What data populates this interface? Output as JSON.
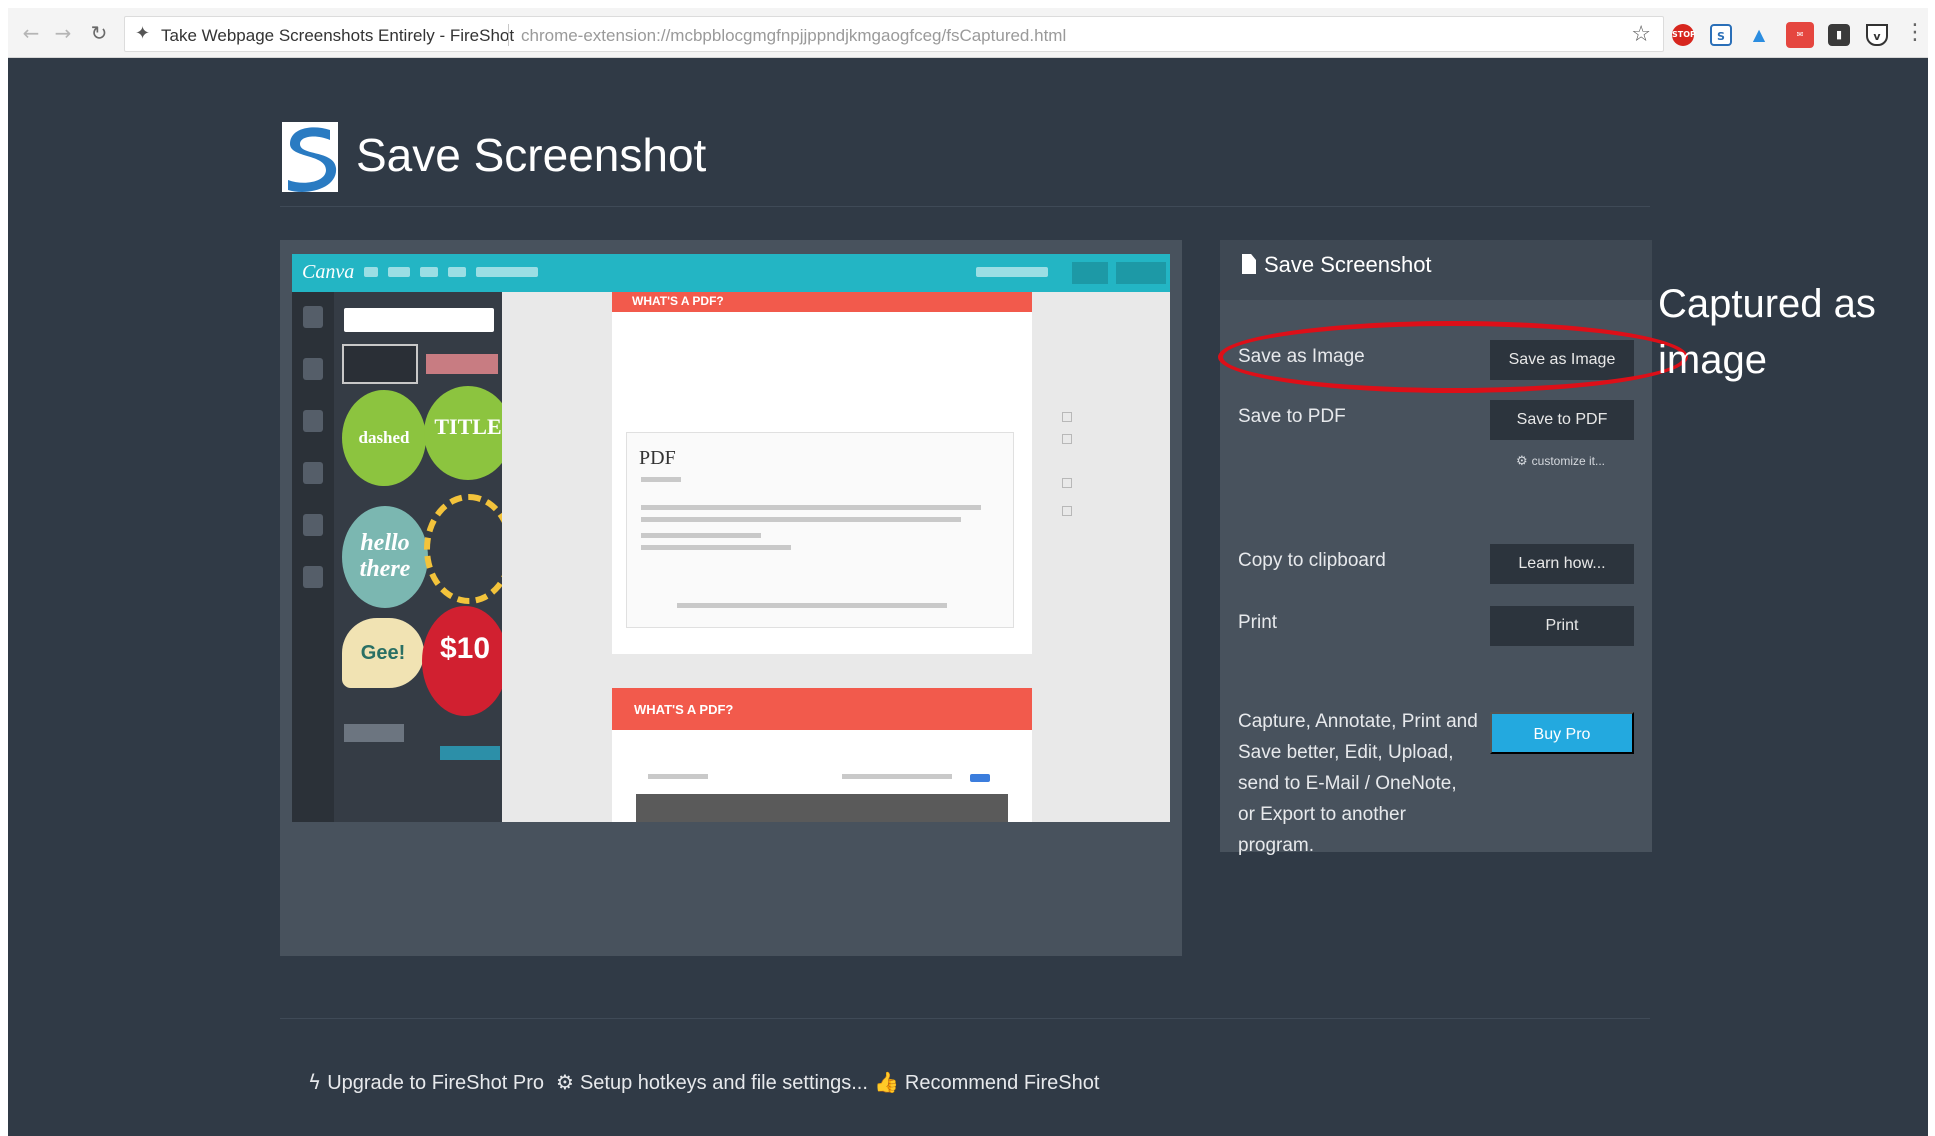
{
  "browser": {
    "tab_title": "Take Webpage Screenshots Entirely - FireShot",
    "url": "chrome-extension://mcbpblocgmgfnpjjppndjkmgaogfceg/fsCaptured.html",
    "back_icon": "back-arrow-icon",
    "forward_icon": "forward-arrow-icon",
    "reload_icon": "reload-icon",
    "bookmark_icon": "star-icon",
    "extensions": [
      "stop-icon",
      "fireshot-icon",
      "cloud-upload-icon",
      "mail-icon",
      "bookmark-icon",
      "pocket-icon"
    ]
  },
  "header": {
    "title": "Save Screenshot"
  },
  "options": {
    "title": "Save Screenshot",
    "save_image": {
      "label": "Save as Image",
      "button": "Save as Image"
    },
    "save_pdf": {
      "label": "Save to PDF",
      "button": "Save to PDF",
      "customize": "customize it..."
    },
    "clipboard": {
      "label": "Copy to clipboard",
      "button": "Learn how..."
    },
    "print": {
      "label": "Print",
      "button": "Print"
    },
    "promo": {
      "text": "Capture, Annotate, Print and Save better, Edit, Upload, send to E-Mail / OneNote, or Export to another program.",
      "button": "Buy Pro"
    }
  },
  "preview": {
    "canva_logo": "Canva",
    "banner_1": "WHAT'S A PDF?",
    "banner_2": "WHAT'S A PDF?",
    "pdf_heading": "PDF",
    "stickers": {
      "dashed": "dashed",
      "title": "TITLE",
      "hello": "hello there",
      "gee": "Gee!",
      "ten": "$10"
    }
  },
  "annotation": {
    "text": "Captured as image",
    "color": "#dd0f18"
  },
  "footer": {
    "upgrade": "Upgrade to FireShot Pro",
    "hotkeys": "Setup hotkeys and file settings...",
    "recommend": "Recommend FireShot"
  },
  "colors": {
    "background": "#303a46",
    "panel": "#48525d",
    "button": "#2c343d",
    "accent": "#23a9df"
  }
}
